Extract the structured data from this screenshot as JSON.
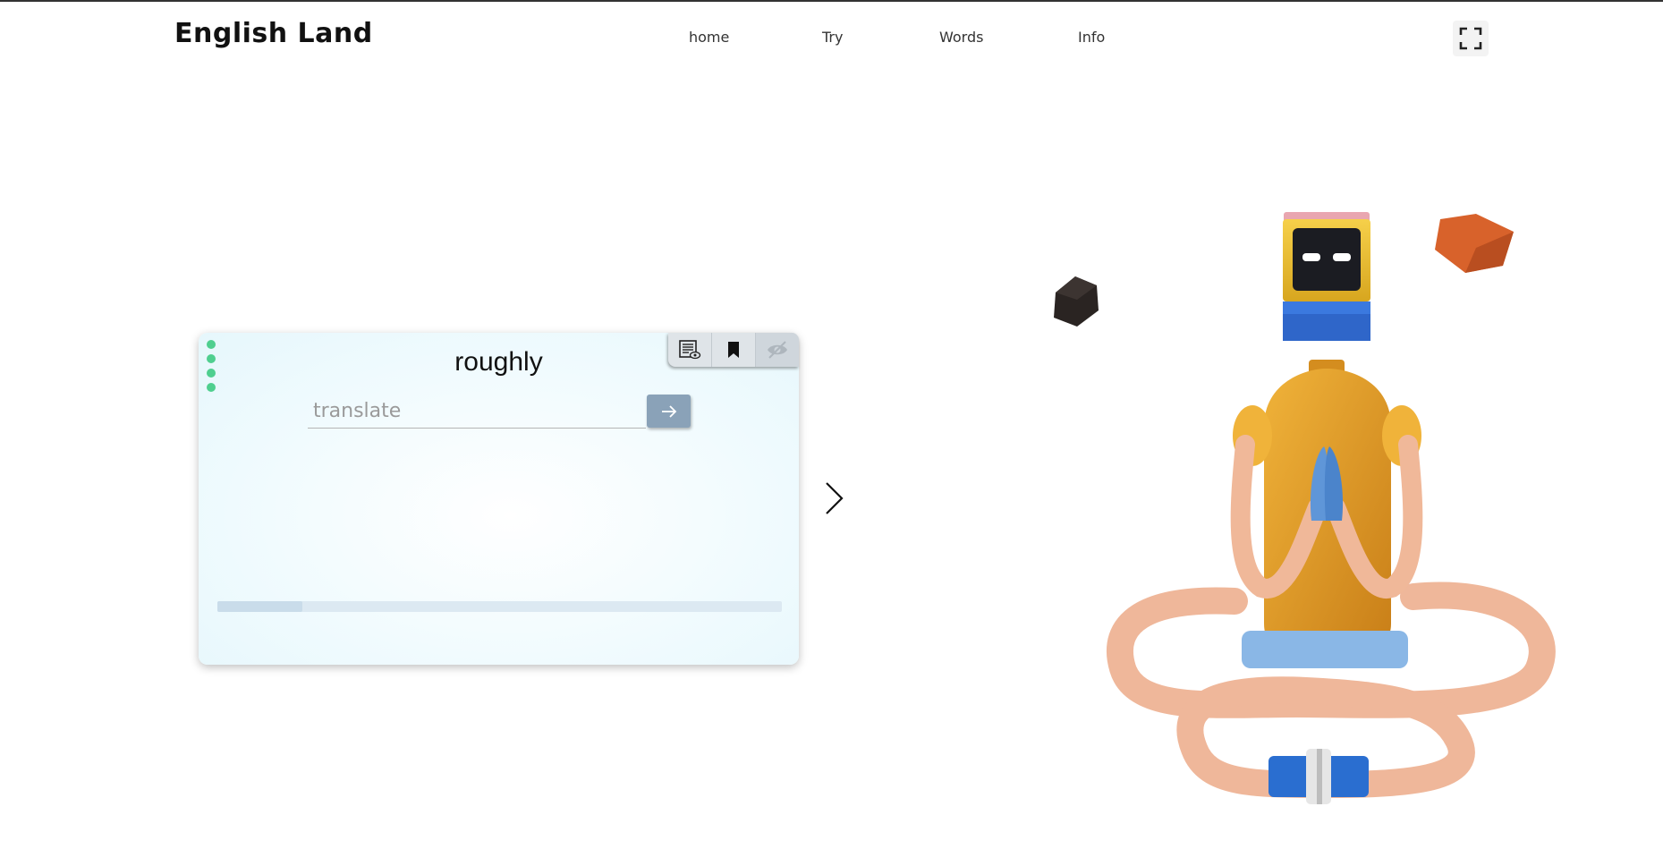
{
  "header": {
    "logo": "English Land",
    "nav": [
      {
        "label": "home"
      },
      {
        "label": "Try"
      },
      {
        "label": "Words"
      },
      {
        "label": "Info"
      }
    ],
    "fullscreen_icon": "expand-icon"
  },
  "card": {
    "word": "roughly",
    "translate_placeholder": "translate",
    "translate_value": "",
    "toolbar_icons": [
      "list-eye-icon",
      "bookmark-icon",
      "eye-off-icon"
    ],
    "progress_fraction": 0.15
  },
  "colors": {
    "accent_dots": "#4fcf8f",
    "submit_button": "#8aa2b8"
  }
}
